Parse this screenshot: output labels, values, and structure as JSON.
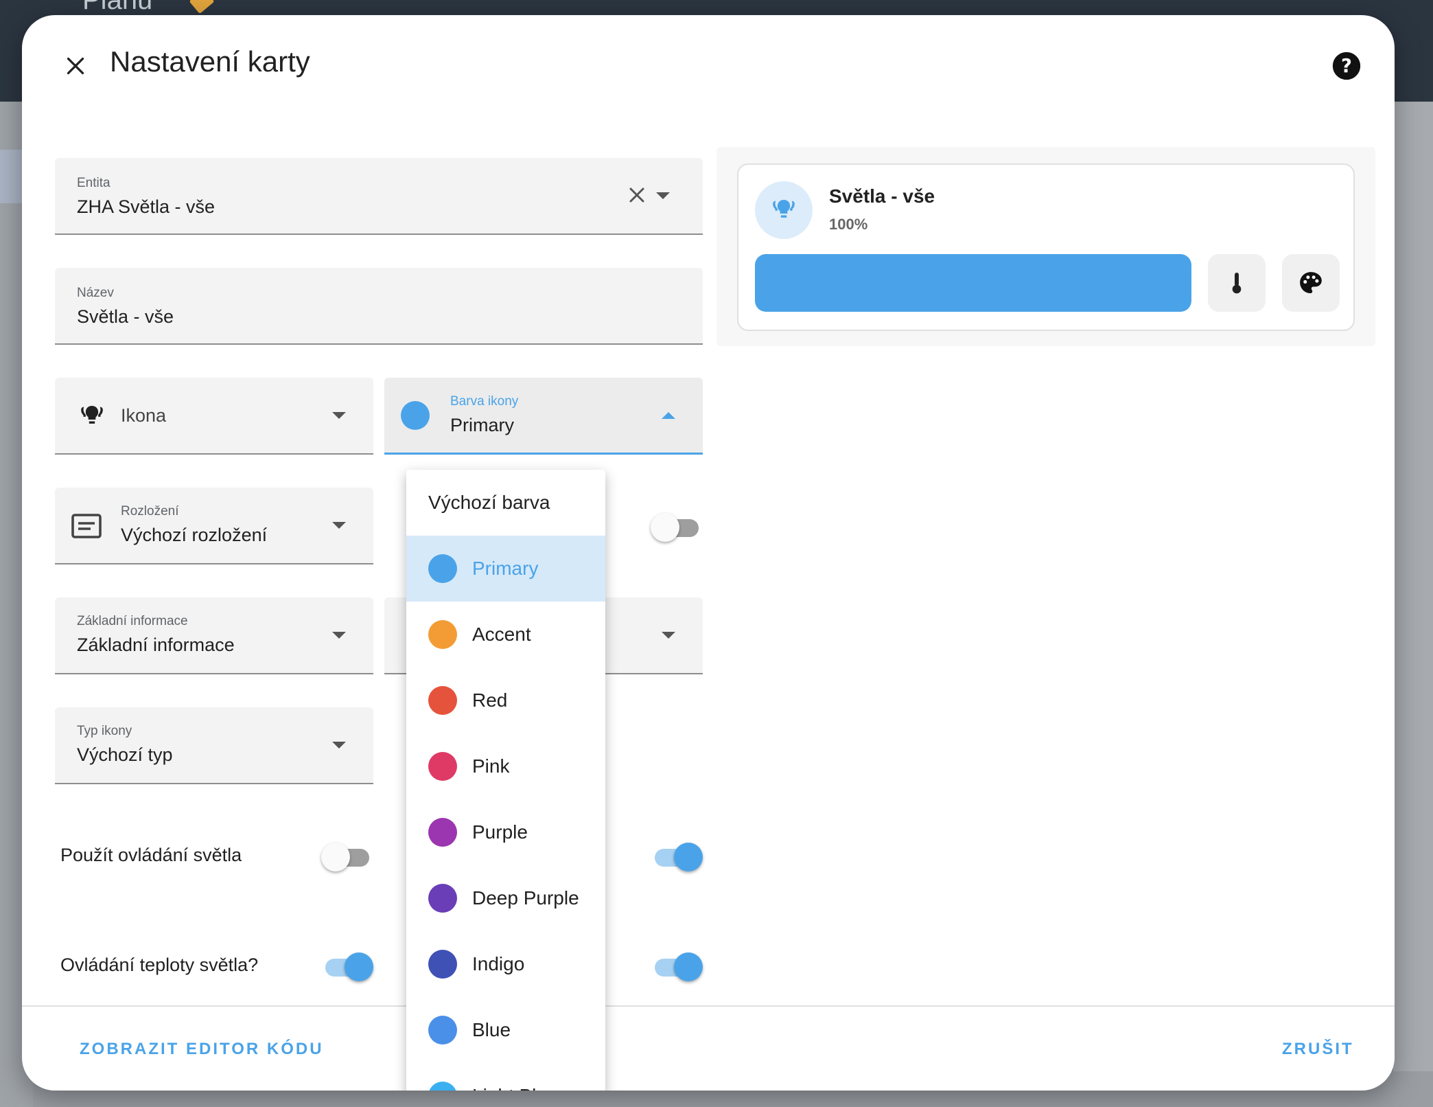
{
  "background": {
    "app_title": "Plánu"
  },
  "dialog": {
    "title": "Nastavení karty",
    "close_icon": "close-icon",
    "help_icon": "help-circle-icon"
  },
  "fields": {
    "entity": {
      "label": "Entita",
      "value": "ZHA Světla - vše"
    },
    "name": {
      "label": "Název",
      "value": "Světla - vše"
    },
    "icon": {
      "value": "Ikona",
      "icon": "lightbulb-group-icon"
    },
    "icon_color": {
      "label": "Barva ikony",
      "value": "Primary",
      "color": "#4aa3e8"
    },
    "layout": {
      "label": "Rozložení",
      "value": "Výchozí rozložení",
      "icon": "card-layout-icon"
    },
    "primary_info": {
      "label": "Základní informace",
      "value": "Základní informace"
    },
    "icon_type": {
      "label": "Typ ikony",
      "value": "Výchozí typ"
    }
  },
  "switches": {
    "use_light_control": {
      "label": "Použít ovládání světla",
      "on": false
    },
    "light_temperature": {
      "label": "Ovládání teploty světla?",
      "on": true
    },
    "right_top": {
      "on": false
    },
    "right_mid": {
      "on": true
    },
    "right_bottom": {
      "on": true
    }
  },
  "preview": {
    "name": "Světla - vše",
    "state": "100%",
    "brightness_percent": 100,
    "accent_color": "#4aa3e8",
    "buttons": [
      "thermometer-icon",
      "palette-icon"
    ]
  },
  "menu": {
    "default_label": "Výchozí barva",
    "items": [
      {
        "label": "Primary",
        "color": "#4aa3e8",
        "selected": true
      },
      {
        "label": "Accent",
        "color": "#f39c35"
      },
      {
        "label": "Red",
        "color": "#e6533c"
      },
      {
        "label": "Pink",
        "color": "#df3a66"
      },
      {
        "label": "Purple",
        "color": "#9c35b0"
      },
      {
        "label": "Deep Purple",
        "color": "#6a3eb6"
      },
      {
        "label": "Indigo",
        "color": "#3f51b5"
      },
      {
        "label": "Blue",
        "color": "#4a90e8"
      },
      {
        "label": "Light Blue",
        "color": "#3ab0f0"
      }
    ]
  },
  "footer": {
    "code_editor": "ZOBRAZIT EDITOR KÓDU",
    "cancel": "ZRUŠIT"
  }
}
